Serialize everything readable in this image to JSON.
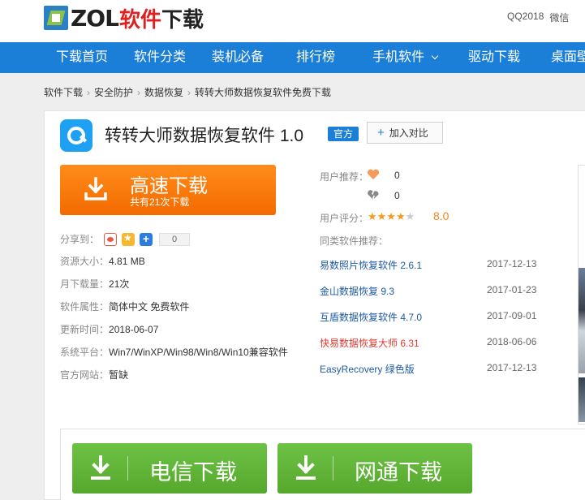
{
  "header": {
    "logo_text": "ZOL",
    "logo_cn_red": "软件",
    "logo_cn": "下载",
    "links": [
      "QQ2018",
      "微信"
    ]
  },
  "nav": {
    "items": [
      {
        "label": "下载首页"
      },
      {
        "label": "软件分类"
      },
      {
        "label": "装机必备"
      },
      {
        "label": "排行榜"
      },
      {
        "label": "手机软件"
      },
      {
        "label": "驱动下载"
      },
      {
        "label": "桌面壁"
      }
    ]
  },
  "breadcrumb": [
    "软件下载",
    "安全防护",
    "数据恢复",
    "转转大师数据恢复软件免费下载"
  ],
  "app": {
    "title": "转转大师数据恢复软件 1.0",
    "badge": "官方",
    "compare_label": "加入对比",
    "icon": "app-logo-icon"
  },
  "fast_download": {
    "title": "高速下载",
    "subtitle": "共有21次下载"
  },
  "share": {
    "label": "分享到：",
    "count": "0",
    "icons": [
      "weibo-icon",
      "qzone-icon",
      "plus-icon"
    ]
  },
  "info": [
    {
      "key": "资源大小：",
      "value": "4.81 MB"
    },
    {
      "key": "月下载量：",
      "value": "21次"
    },
    {
      "key": "软件属性：",
      "value": "简体中文 免费软件"
    },
    {
      "key": "更新时间：",
      "value": "2018-06-07"
    },
    {
      "key": "系统平台：",
      "value": "Win7/WinXP/Win98/Win8/Win10兼容软件"
    },
    {
      "key": "官方网站：",
      "value": "暂缺"
    }
  ],
  "rating": {
    "recommend_label": "用户推荐：",
    "likes": "0",
    "dislikes": "0",
    "score_label": "用户评分：",
    "stars": "★★★★",
    "stars_off": "★",
    "stars_value": 4,
    "score": "8.0"
  },
  "similar": {
    "label": "同类软件推荐：",
    "items": [
      {
        "name": "易数照片恢复软件 2.6.1",
        "date": "2017-12-13"
      },
      {
        "name": "金山数据恢复 9.3",
        "date": "2017-01-23"
      },
      {
        "name": "互盾数据恢复软件 4.7.0",
        "date": "2017-09-01"
      },
      {
        "name": "快易数据恢复大师 6.31",
        "date": "2018-06-06"
      },
      {
        "name": "EasyRecovery 绿色版",
        "date": "2017-12-13"
      }
    ]
  },
  "downloads": [
    {
      "label": "电信下载"
    },
    {
      "label": "网通下载"
    }
  ],
  "colors": {
    "nav_blue": "#1b7fd8",
    "fast_orange": "#f37b0c",
    "green": "#5fb537",
    "link_blue": "#1e5aa8",
    "highlight_red": "#e03c31"
  }
}
